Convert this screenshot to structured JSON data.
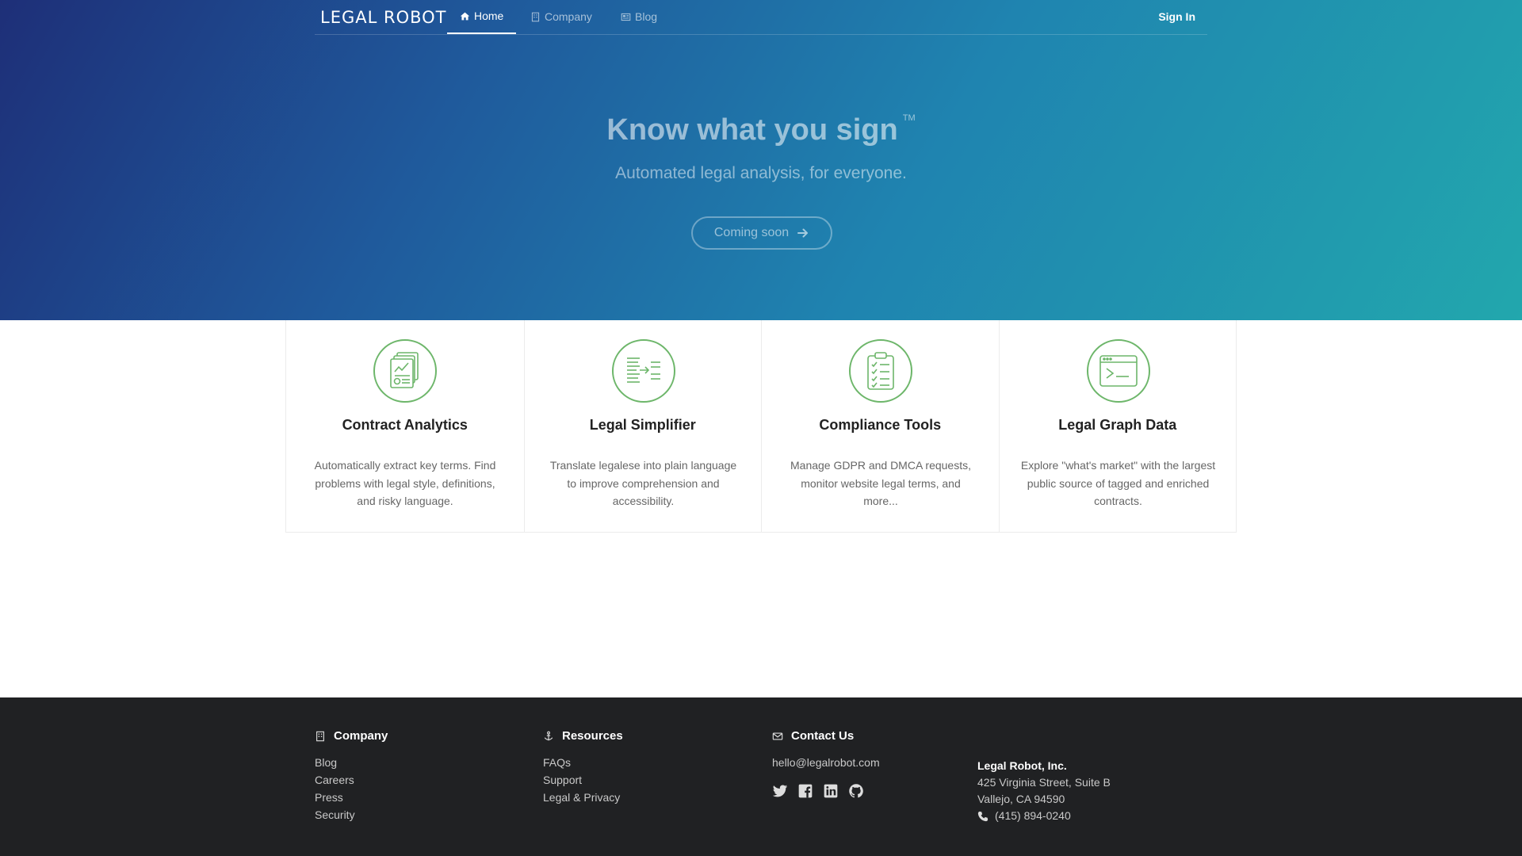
{
  "nav": {
    "logo": "LEGAL ROBOT",
    "items": [
      {
        "label": "Home",
        "icon": "home-icon",
        "active": true
      },
      {
        "label": "Company",
        "icon": "building-icon",
        "active": false
      },
      {
        "label": "Blog",
        "icon": "newspaper-icon",
        "active": false
      }
    ],
    "signin": "Sign In"
  },
  "hero": {
    "title": "Know what you sign",
    "tm": "TM",
    "subtitle": "Automated legal analysis, for everyone.",
    "cta": "Coming soon"
  },
  "features": [
    {
      "icon": "document-chart-icon",
      "title": "Contract Analytics",
      "desc": "Automatically extract key terms. Find problems with legal style, definitions, and risky language."
    },
    {
      "icon": "text-transform-icon",
      "title": "Legal Simplifier",
      "desc": "Translate legalese into plain language to improve comprehension and accessibility."
    },
    {
      "icon": "clipboard-checklist-icon",
      "title": "Compliance Tools",
      "desc": "Manage GDPR and DMCA requests, monitor website legal terms, and more..."
    },
    {
      "icon": "terminal-window-icon",
      "title": "Legal Graph Data",
      "desc": "Explore \"what's market\" with the largest public source of tagged and enriched contracts."
    }
  ],
  "footer": {
    "company": {
      "heading": "Company",
      "links": [
        "Blog",
        "Careers",
        "Press",
        "Security"
      ]
    },
    "resources": {
      "heading": "Resources",
      "links": [
        "FAQs",
        "Support",
        "Legal & Privacy"
      ]
    },
    "contact": {
      "heading": "Contact Us",
      "email": "hello@legalrobot.com",
      "social": [
        "twitter-icon",
        "facebook-icon",
        "linkedin-icon",
        "github-icon"
      ]
    },
    "address": {
      "org": "Legal Robot, Inc.",
      "line1": "425 Virginia Street, Suite B",
      "line2": "Vallejo, CA 94590",
      "phone": "(415) 894-0240"
    }
  },
  "colors": {
    "accent": "#6db66a",
    "hero_start": "#1e2f78",
    "hero_end": "#22a7ad",
    "footer_bg": "#202123"
  }
}
